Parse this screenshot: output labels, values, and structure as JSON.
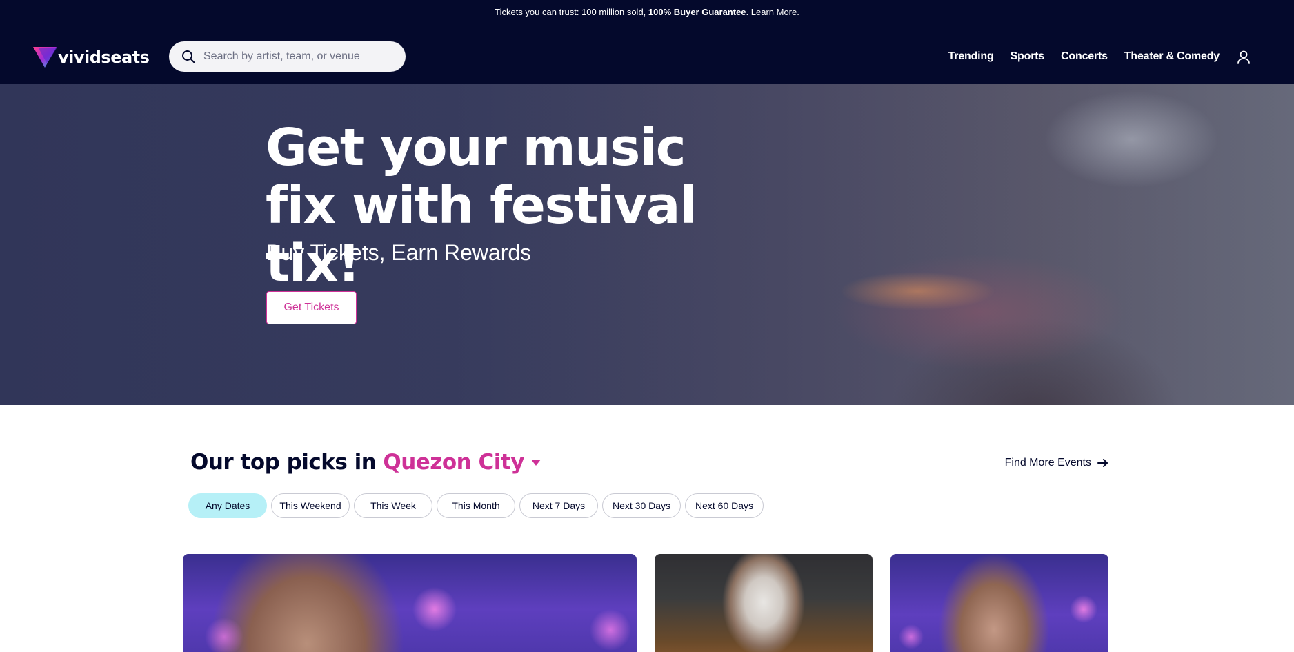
{
  "promo": {
    "prefix": "Tickets you can trust: 100 million sold, ",
    "bold": "100% Buyer Guarantee",
    "suffix": ". Learn More."
  },
  "brand": {
    "logo_text": "vividseats",
    "colors": {
      "navy": "#04092c",
      "accent_pink": "#ce3197",
      "chip_active": "#b6f0f7"
    }
  },
  "search": {
    "placeholder": "Search by artist, team, or venue",
    "icon": "search-icon"
  },
  "nav": {
    "items": [
      "Trending",
      "Sports",
      "Concerts",
      "Theater & Comedy"
    ],
    "account_icon": "user-icon"
  },
  "hero": {
    "title": "Get your music fix with festival tix!",
    "subtitle": "Buy Tickets, Earn Rewards",
    "button_label": "Get Tickets"
  },
  "picks": {
    "heading_prefix": "Our top picks in",
    "city": "Quezon City",
    "find_more_label": "Find More Events",
    "date_filters": [
      {
        "label": "Any Dates",
        "active": true
      },
      {
        "label": "This Weekend",
        "active": false
      },
      {
        "label": "This Week",
        "active": false
      },
      {
        "label": "This Month",
        "active": false
      },
      {
        "label": "Next 7 Days",
        "active": false
      },
      {
        "label": "Next 30 Days",
        "active": false
      },
      {
        "label": "Next 60 Days",
        "active": false
      }
    ]
  }
}
